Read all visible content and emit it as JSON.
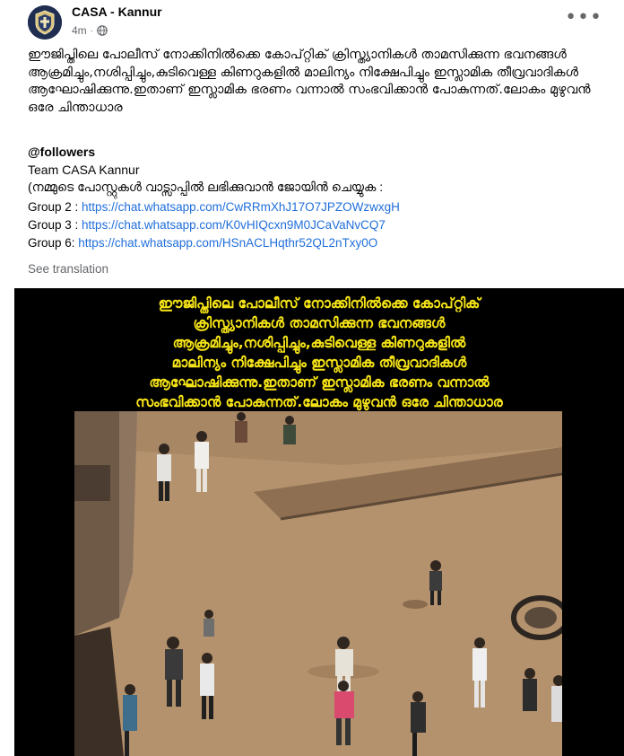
{
  "post": {
    "author": "CASA - Kannur",
    "time": "4m",
    "body_text": "ഈജിപ്തിലെ പോലീസ് നോക്കിനിൽക്കെ കോപ്റ്റിക് ക്രിസ്ത്യാനികൾ താമസിക്കുന്ന ഭവനങ്ങൾ ആക്രമിച്ചും,നശിപ്പിച്ചും,കുടിവെള്ള കിണറുകളിൽ മാലിന്യം നിക്ഷേപിച്ചും ഇസ്ലാമിക തീവ്രവാദികൾ ആഘോഷിക്കുന്നു.ഇതാണ് ഇസ്ലാമിക ഭരണം വന്നാൽ സംഭവിക്കാൻ പോകുന്നത്.ലോകം മുഴുവൻ ഒരേ ചിന്താധാര",
    "mention": "@followers",
    "team": "Team CASA Kannur",
    "join_note": "(നമ്മുടെ പോസ്റ്റുകൾ വാട്സാപ്പിൽ ലഭിക്കുവാൻ ജോയിൻ ചെയ്യുക :",
    "groups": [
      {
        "label": "Group 2 :",
        "url": "https://chat.whatsapp.com/CwRRmXhJ17O7JPZOWzwxgH"
      },
      {
        "label": "Group 3 :",
        "url": "https://chat.whatsapp.com/K0vHIQcxn9M0JCaVaNvCQ7"
      },
      {
        "label": "Group 6:",
        "url": "https://chat.whatsapp.com/HSnACLHqthr52QL2nTxy0O"
      }
    ],
    "see_translation": "See translation",
    "more_icon": "more-horizontal-icon",
    "privacy_icon": "globe-icon"
  },
  "media": {
    "caption": "ഈജിപ്തിലെ പോലീസ് നോക്കിനിൽക്കെ കോപ്റ്റിക്\nക്രിസ്ത്യാനികൾ താമസിക്കുന്ന ഭവനങ്ങൾ\nആക്രമിച്ചും,നശിപ്പിച്ചും,കുടിവെള്ള കിണറുകളിൽ\nമാലിന്യം നിക്ഷേപിച്ചും ഇസ്ലാമിക തീവ്രവാദികൾ\nആഘോഷിക്കുന്നു.ഇതാണ് ഇസ്ലാമിക ഭരണം വന്നാൽ\nസംഭവിക്കാൻ പോകുന്നത്.ലോകം മുഴുവൻ ഒരേ ചിന്താധാര",
    "caption_color": "#f5e317"
  },
  "colors": {
    "link": "#216fdb",
    "secondary_text": "#65676b"
  }
}
